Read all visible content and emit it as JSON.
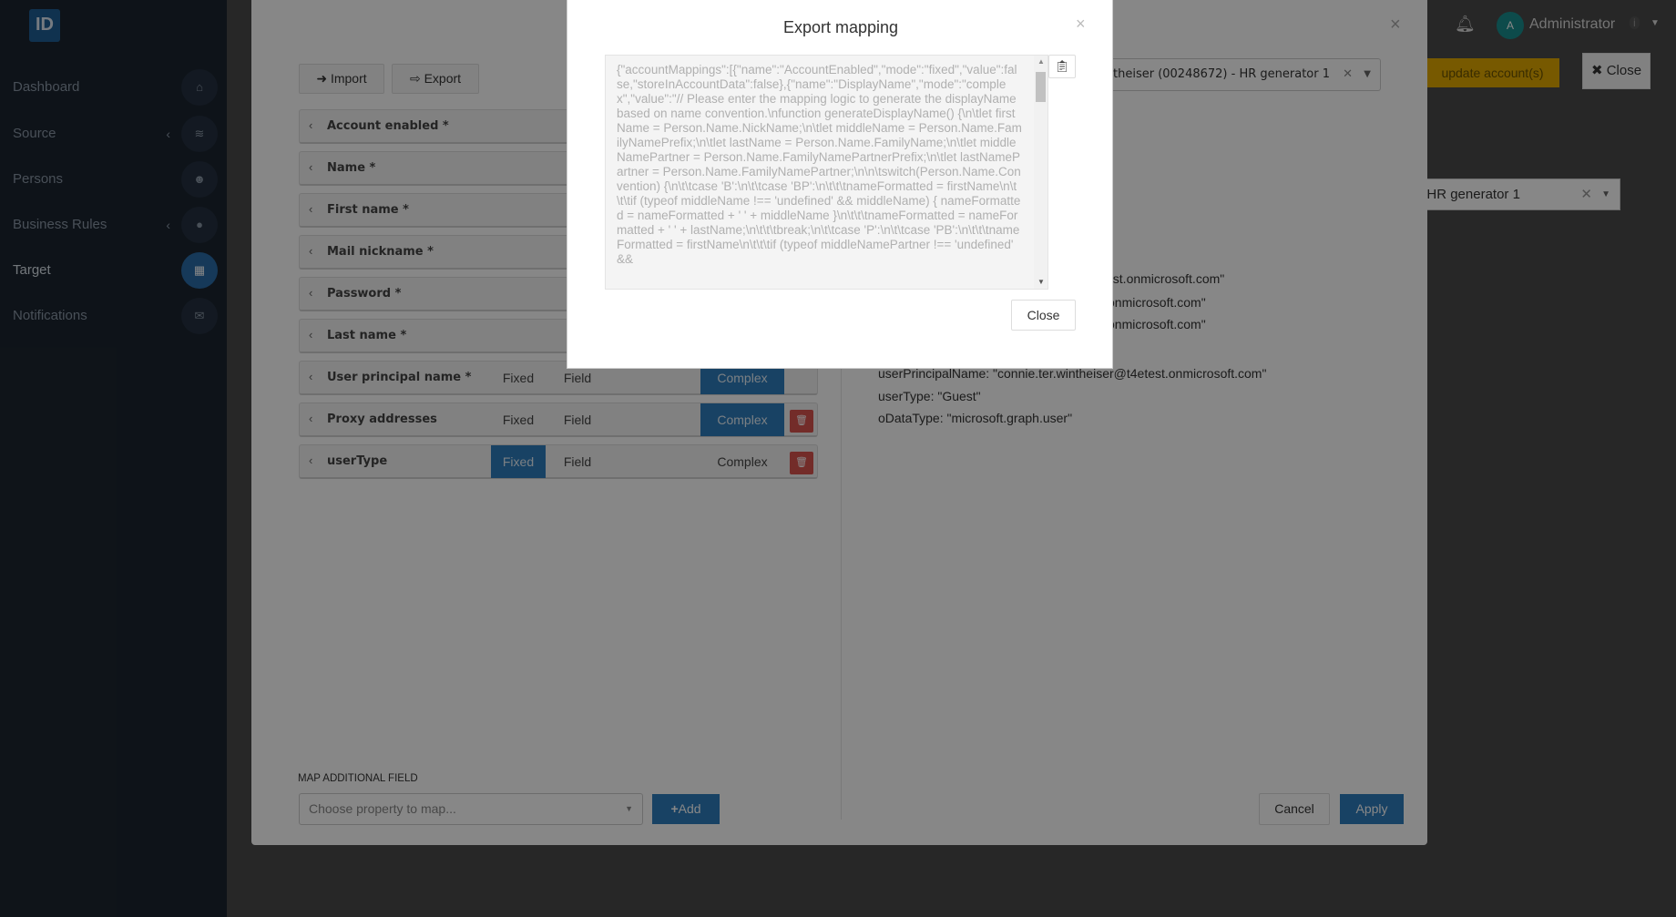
{
  "sidebar": {
    "logo": "ID",
    "items": [
      {
        "label": "Dashboard",
        "icon": "home-icon",
        "glyph": "⌂"
      },
      {
        "label": "Source",
        "icon": "layers-icon",
        "glyph": "≋",
        "chevron": "‹"
      },
      {
        "label": "Persons",
        "icon": "users-icon",
        "glyph": "☻"
      },
      {
        "label": "Business Rules",
        "icon": "globe-icon",
        "glyph": "●",
        "chevron": "‹"
      },
      {
        "label": "Target",
        "icon": "grid-icon",
        "glyph": "▦",
        "active": true
      },
      {
        "label": "Notifications",
        "icon": "envelope-icon",
        "glyph": "✉"
      }
    ]
  },
  "topbar": {
    "user": "Administrator",
    "avatar": "A",
    "badge": "i",
    "update_button": "update account(s)",
    "close_label": "Close",
    "person_select": "248672) - HR generator 1"
  },
  "dialog": {
    "import_label": "Import",
    "export_label": "Export",
    "mode_labels": {
      "fixed": "Fixed",
      "field": "Field",
      "complex": "Complex"
    },
    "rows": [
      {
        "label": "Account enabled *"
      },
      {
        "label": "Name *"
      },
      {
        "label": "First name *"
      },
      {
        "label": "Mail nickname *"
      },
      {
        "label": "Password *"
      },
      {
        "label": "Last name *"
      },
      {
        "label": "User principal name *",
        "mode": "complex",
        "deletable": false
      },
      {
        "label": "Proxy addresses",
        "mode": "complex",
        "deletable": true
      },
      {
        "label": "userType",
        "mode": "fixed",
        "deletable": true
      }
    ],
    "person_select": "theiser (00248672) - HR generator 1",
    "preview_lines": [
      "est.onmicrosoft.com\"",
      "onmicrosoft.com\"",
      "onmicrosoft.com\"",
      "userPrincipalName: \"connie.ter.wintheiser@t4etest.onmicrosoft.com\"",
      "userType: \"Guest\"",
      "oDataType: \"microsoft.graph.user\""
    ],
    "map_additional_label": "MAP ADDITIONAL FIELD",
    "map_placeholder": "Choose property to map...",
    "add_label": "Add",
    "cancel_label": "Cancel",
    "apply_label": "Apply"
  },
  "export_modal": {
    "title": "Export mapping",
    "close_label": "Close",
    "json_text": "{\"accountMappings\":[{\"name\":\"AccountEnabled\",\"mode\":\"fixed\",\"value\":false,\"storeInAccountData\":false},{\"name\":\"DisplayName\",\"mode\":\"complex\",\"value\":\"// Please enter the mapping logic to generate the displayName based on name convention.\\nfunction generateDisplayName() {\\n\\tlet firstName = Person.Name.NickName;\\n\\tlet middleName = Person.Name.FamilyNamePrefix;\\n\\tlet lastName = Person.Name.FamilyName;\\n\\tlet middleNamePartner = Person.Name.FamilyNamePartnerPrefix;\\n\\tlet lastNamePartner = Person.Name.FamilyNamePartner;\\n\\n\\tswitch(Person.Name.Convention) {\\n\\t\\tcase 'B':\\n\\t\\tcase 'BP':\\n\\t\\t\\tnameFormatted = firstName\\n\\t\\t\\tif (typeof middleName !== 'undefined' && middleName) { nameFormatted = nameFormatted + ' ' + middleName }\\n\\t\\t\\tnameFormatted = nameFormatted + ' ' + lastName;\\n\\t\\t\\tbreak;\\n\\t\\tcase 'P':\\n\\t\\tcase 'PB':\\n\\t\\t\\tnameFormatted = firstName\\n\\t\\t\\tif (typeof middleNamePartner !== 'undefined' &&"
  },
  "colors": {
    "primary": "#2f7ebd",
    "danger": "#d9534f",
    "warning": "#e0a800"
  }
}
